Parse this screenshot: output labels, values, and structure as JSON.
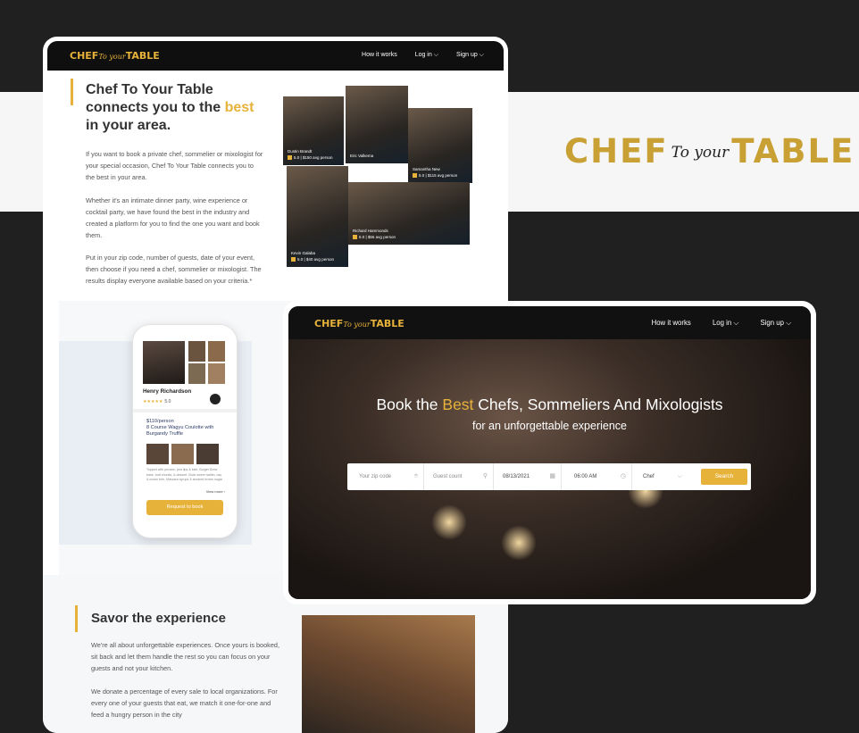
{
  "brand": {
    "logo_left": "CHEF",
    "logo_script": "To your",
    "logo_right": "TABLE",
    "color": "#c8a034"
  },
  "nav": {
    "how": "How it works",
    "login": "Log in",
    "signup": "Sign up"
  },
  "intro": {
    "title_1": "Chef To Your Table connects you to the ",
    "title_gold": "best",
    "title_2": " in your area.",
    "p1": "If you want to book a private chef, sommelier or mixologist for your special occasion, Chef To Your Table connects you to the best in your area.",
    "p2": "Whether it's an intimate dinner party, wine experience or cocktail party, we have found the best in the industry and created a platform for you to find the one you want and book them.",
    "p3": "Put in your zip code, number of guests, date of your event, then choose if you need a chef, sommelier or mixologist. The results display everyone available based on your criteria.*"
  },
  "collage": [
    {
      "name": "Dustin Brandt",
      "meta": "5.0 | $150 avg person"
    },
    {
      "name": "Eric Valkema",
      "meta": ""
    },
    {
      "name": "Samantha New",
      "meta": "5.0 | $115 avg person"
    },
    {
      "name": "Kevin Galaba",
      "meta": "5.0 | $40 avg person"
    },
    {
      "name": "Richard Hammonds",
      "meta": "5.0 | $55 avg person"
    }
  ],
  "phone": {
    "name": "Henry Richardson",
    "rating": "★★★★★",
    "rating_value": "5.0",
    "price": "$110/person",
    "course": "8 Course Wagyu Coulotte with Burgandy Truffle",
    "desc": "Topped with pecans, pea tips & kale, Burger Brew base, butt chunks, & dessert. Buck sweet radish, cay & crown brie, Mascara syrups & smoked brown sugar",
    "view_more": "View more",
    "button": "Request to book"
  },
  "savor": {
    "title": "Savor the experience",
    "p1": "We're all about unforgettable experiences. Once yours is booked, sit back and let them handle the rest so you can focus on your guests and not your kitchen.",
    "p2": "We donate a percentage of every sale to local organizations. For every one of your guests that eat, we match it one-for-one and feed a hungry person in the city"
  },
  "hero": {
    "headline_1": "Book the ",
    "headline_gold": "Best",
    "headline_2": " Chefs, Sommeliers And Mixologists",
    "subline": "for an unforgettable experience",
    "zip_placeholder": "Your zip code",
    "guests_placeholder": "Guest count",
    "date": "08/13/2021",
    "time": "06:00 AM",
    "type": "Chef",
    "search": "Search"
  }
}
